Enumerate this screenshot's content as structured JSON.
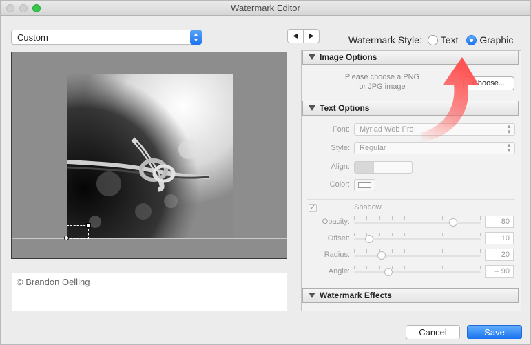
{
  "window": {
    "title": "Watermark Editor"
  },
  "preset": {
    "value": "Custom"
  },
  "nav": {
    "prev_icon": "triangle-left-icon",
    "next_icon": "triangle-right-icon"
  },
  "watermark_style": {
    "label": "Watermark Style:",
    "options": [
      {
        "label": "Text",
        "selected": false
      },
      {
        "label": "Graphic",
        "selected": true
      }
    ]
  },
  "preview": {
    "caption_text": "© Brandon Oelling"
  },
  "image_options": {
    "header": "Image Options",
    "hint": "Please choose a PNG or JPG image",
    "choose_label": "Choose..."
  },
  "text_options": {
    "header": "Text Options",
    "font_label": "Font:",
    "font_value": "Myriad Web Pro",
    "style_label": "Style:",
    "style_value": "Regular",
    "align_label": "Align:",
    "align_selected": "left",
    "color_label": "Color:",
    "shadow_checked": true,
    "shadow_label": "Shadow",
    "sliders": [
      {
        "label": "Opacity:",
        "value": "80",
        "level": 0.78
      },
      {
        "label": "Offset:",
        "value": "10",
        "level": 0.12
      },
      {
        "label": "Radius:",
        "value": "20",
        "level": 0.22
      },
      {
        "label": "Angle:",
        "value": "– 90",
        "level": 0.27
      }
    ]
  },
  "watermark_effects": {
    "header": "Watermark Effects"
  },
  "buttons": {
    "cancel": "Cancel",
    "save": "Save"
  },
  "colors": {
    "accent": "#1f76ef",
    "highlight_arrow": "#ff5a5a"
  }
}
